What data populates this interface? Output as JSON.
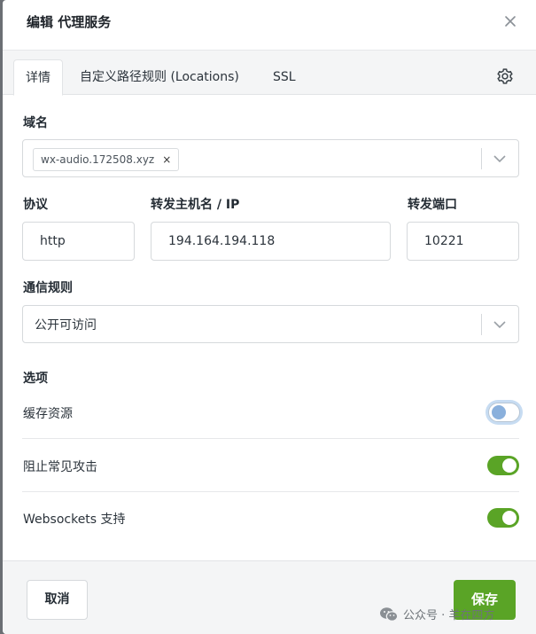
{
  "dialog": {
    "title": "编辑 代理服务"
  },
  "tabs": [
    {
      "label": "详情",
      "active": true
    },
    {
      "label": "自定义路径规则 (Locations)",
      "active": false
    },
    {
      "label": "SSL",
      "active": false
    }
  ],
  "domain": {
    "label": "域名",
    "tags": [
      {
        "value": "wx-audio.172508.xyz",
        "remove": "×"
      }
    ]
  },
  "forward": {
    "scheme_label": "协议",
    "scheme_value": "http",
    "host_label": "转发主机名 / IP",
    "host_value": "194.164.194.118",
    "port_label": "转发端口",
    "port_value": "10221"
  },
  "access": {
    "label": "通信规则",
    "value": "公开可访问"
  },
  "options": {
    "label": "选项",
    "items": [
      {
        "label": "缓存资源",
        "enabled": false
      },
      {
        "label": "阻止常见攻击",
        "enabled": true
      },
      {
        "label": "Websockets 支持",
        "enabled": true
      }
    ]
  },
  "footer": {
    "cancel_label": "取消",
    "save_label": "保存"
  },
  "watermark": {
    "text": "公众号 · 羊在四方"
  },
  "colors": {
    "accent": "#5aa426",
    "toggle_off_border": "#b8c6d4",
    "focus_ring": "#c7dcf2"
  },
  "icons": {
    "close": "close-icon",
    "settings": "gear-icon",
    "dropdown": "chevron-down-icon",
    "brand": "wechat-icon"
  }
}
